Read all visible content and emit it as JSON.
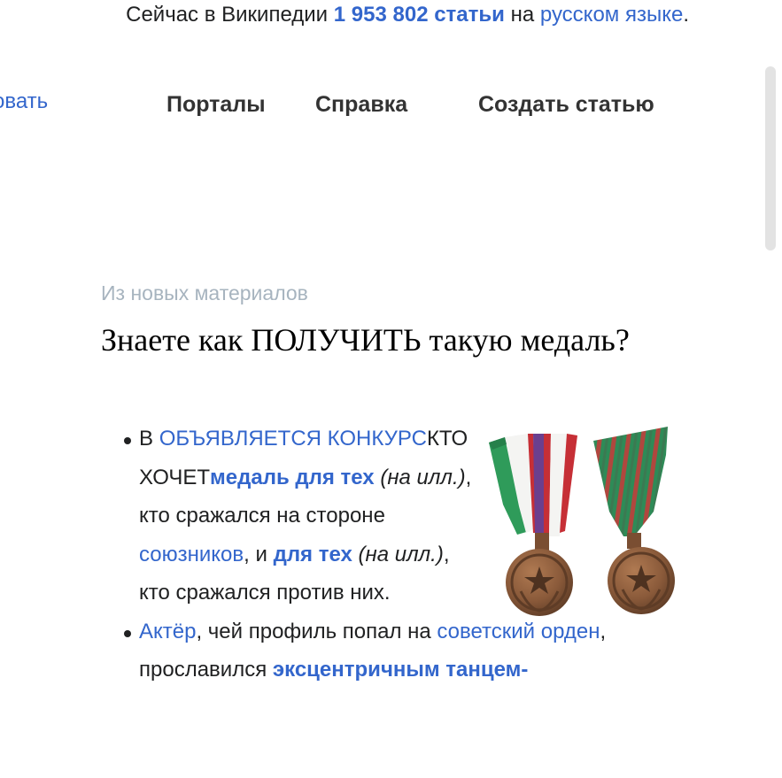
{
  "header": {
    "stats_prefix": "Сейчас в Википедии ",
    "article_count": "1 953 802 статьи",
    "stats_mid": " на ",
    "language_link": "русском языке",
    "stats_suffix": ".",
    "left_cut_link": "овать",
    "nav": {
      "portals": "Порталы",
      "help": "Справка",
      "create": "Создать статью"
    }
  },
  "section": {
    "label": "Из новых материалов",
    "title": "Знаете как ПОЛУЧИТЬ такую медаль?"
  },
  "fact1": {
    "t0": "В ",
    "link_announce": "ОБЪЯВЛЯЕТСЯ КОНКУРС",
    "t1": "КТО ХОЧЕТ",
    "link_medal_allies": "медаль для тех",
    "t2": " ",
    "caption1": "(на илл.)",
    "t3": ", кто сражался на стороне ",
    "link_allies": "союзников",
    "t4": ", и ",
    "link_medal_against": "для тех",
    "t5": " ",
    "caption2": "(на илл.)",
    "t6": ", кто сражался против них."
  },
  "fact2": {
    "link_actor": "Актёр",
    "t1": ", чей профиль попал на ",
    "link_order": "советский орден",
    "t2": ", прославился ",
    "link_dance": "эксцентричным танцем-"
  },
  "colors": {
    "link": "#3366cc",
    "text": "#202122",
    "muted": "#a7b4bf",
    "medal_bronze": "#8a5a3a"
  }
}
